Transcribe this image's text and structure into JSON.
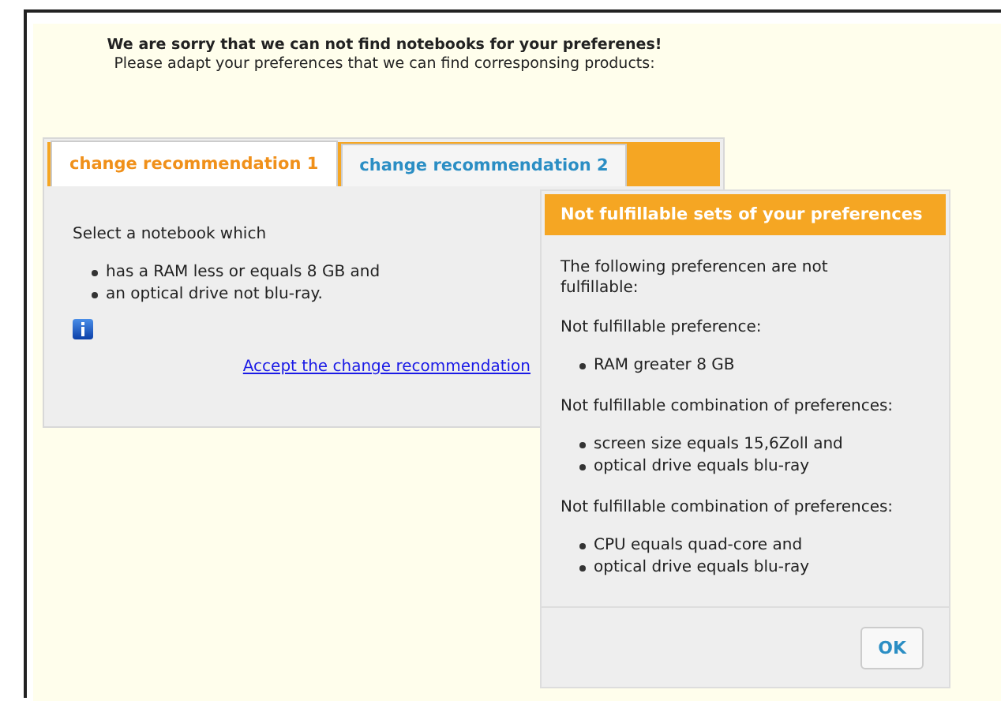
{
  "message": {
    "title": "We are sorry that we can not find notebooks for your preferenes!",
    "subtitle": "Please adapt your preferences that we can find corresponsing products:"
  },
  "tabs": [
    {
      "label": "change recommendation 1",
      "selected": true
    },
    {
      "label": "change recommendation 2",
      "selected": false
    }
  ],
  "recommendation": {
    "intro": "Select a notebook which",
    "items": [
      "has a RAM less or equals 8 GB and",
      "an optical drive not blu-ray."
    ],
    "link": "Accept the change recommendation"
  },
  "dialog": {
    "title": "Not fulfillable sets of your preferences",
    "intro": "The following preferencen are not fulfillable:",
    "groups": [
      {
        "heading": "Not fulfillable preference:",
        "items": [
          "RAM greater 8 GB"
        ]
      },
      {
        "heading": "Not fulfillable combination of preferences:",
        "items": [
          "screen size equals 15,6Zoll and",
          "optical drive equals blu-ray"
        ]
      },
      {
        "heading": "Not fulfillable combination of preferences:",
        "items": [
          "CPU equals quad-core and",
          "optical drive equals blu-ray"
        ]
      }
    ],
    "button": "OK"
  }
}
